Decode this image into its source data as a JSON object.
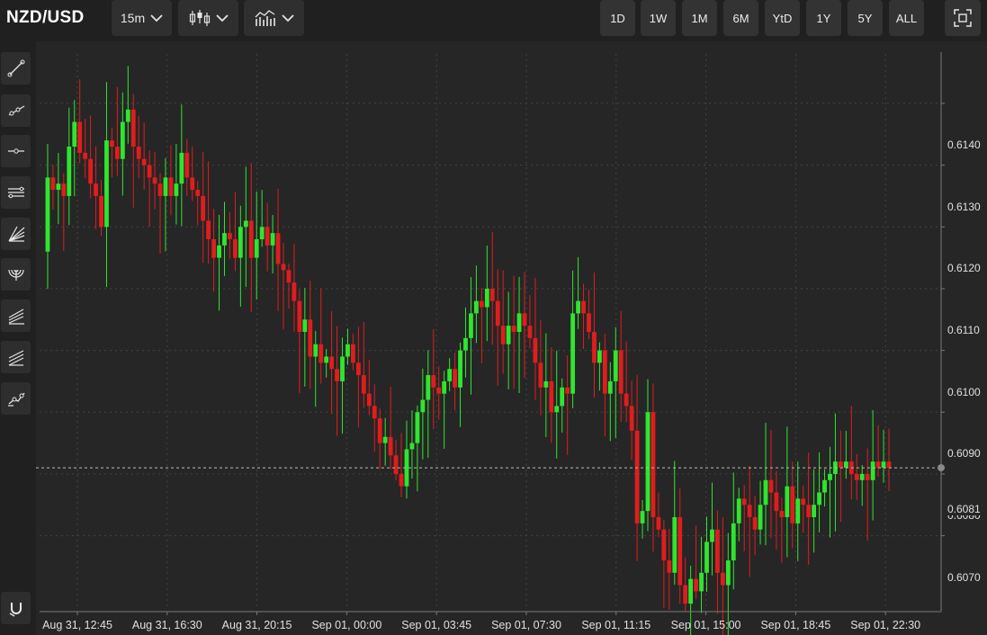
{
  "header": {
    "symbol": "NZD/USD",
    "interval": "15m",
    "candle_style_icon": "candlestick-icon",
    "indicators_icon": "indicators-icon",
    "ranges": [
      "1D",
      "1W",
      "1M",
      "6M",
      "YtD",
      "1Y",
      "5Y",
      "ALL"
    ],
    "fullscreen_icon": "fullscreen-icon"
  },
  "tools": [
    "trend-line-icon",
    "ray-icon",
    "horizontal-line-icon",
    "parallel-channel-icon",
    "fib-fan-icon",
    "fib-arc-icon",
    "pitchfork-icon",
    "regression-channel-icon",
    "polyline-icon",
    "magnet-icon"
  ],
  "colors": {
    "up": "#2ee62e",
    "down": "#e01d1d",
    "background": "#262626",
    "grid": "#444444"
  },
  "chart_data": {
    "type": "candlestick",
    "pair": "NZD/USD",
    "interval": "15m",
    "current_price": "0.6081",
    "current_price_line": 0.6081,
    "ylim": [
      0.6058,
      0.6148
    ],
    "yticks": [
      "0.6140",
      "0.6130",
      "0.6120",
      "0.6110",
      "0.6100",
      "0.6090",
      "0.6080",
      "0.6070"
    ],
    "xticks": [
      "Aug 31, 12:45",
      "Aug 31, 16:30",
      "Aug 31, 20:15",
      "Sep 01, 00:00",
      "Sep 01, 03:45",
      "Sep 01, 07:30",
      "Sep 01, 11:15",
      "Sep 01, 15:00",
      "Sep 01, 18:45",
      "Sep 01, 22:30"
    ],
    "grid": true,
    "close_path": [
      0.6116,
      0.6128,
      0.6126,
      0.6127,
      0.6125,
      0.6133,
      0.6137,
      0.6132,
      0.6131,
      0.6127,
      0.6125,
      0.612,
      0.6134,
      0.6133,
      0.6131,
      0.6137,
      0.6139,
      0.6133,
      0.6131,
      0.613,
      0.6128,
      0.6127,
      0.6125,
      0.6128,
      0.6125,
      0.6127,
      0.6132,
      0.6128,
      0.6126,
      0.6125,
      0.6121,
      0.6118,
      0.6115,
      0.6117,
      0.6119,
      0.6118,
      0.6115,
      0.612,
      0.6121,
      0.6115,
      0.6118,
      0.612,
      0.6117,
      0.6119,
      0.6114,
      0.6113,
      0.6111,
      0.6108,
      0.6103,
      0.6105,
      0.6099,
      0.6101,
      0.6098,
      0.6099,
      0.6097,
      0.6095,
      0.6099,
      0.6101,
      0.6098,
      0.6096,
      0.6093,
      0.6091,
      0.6089,
      0.6085,
      0.6086,
      0.6083,
      0.608,
      0.6078,
      0.6084,
      0.6085,
      0.609,
      0.6092,
      0.6096,
      0.6094,
      0.6093,
      0.6095,
      0.6097,
      0.6094,
      0.61,
      0.6102,
      0.6106,
      0.6108,
      0.6107,
      0.611,
      0.6108,
      0.6104,
      0.6101,
      0.6104,
      0.6103,
      0.6106,
      0.6104,
      0.6102,
      0.6098,
      0.6094,
      0.6095,
      0.609,
      0.6091,
      0.6094,
      0.6093,
      0.6106,
      0.6108,
      0.6106,
      0.6103,
      0.6098,
      0.61,
      0.6093,
      0.6095,
      0.61,
      0.6093,
      0.6091,
      0.6087,
      0.6072,
      0.6074,
      0.609,
      0.6073,
      0.6071,
      0.6066,
      0.6064,
      0.6073,
      0.6062,
      0.6059,
      0.6063,
      0.6061,
      0.6064,
      0.6069,
      0.6071,
      0.6064,
      0.6062,
      0.6066,
      0.6072,
      0.6076,
      0.6075,
      0.6073,
      0.6071,
      0.6075,
      0.6079,
      0.6077,
      0.6074,
      0.6073,
      0.6078,
      0.6072,
      0.6076,
      0.6075,
      0.6073,
      0.6075,
      0.6077,
      0.6079,
      0.608,
      0.6082,
      0.6081,
      0.6082,
      0.608,
      0.6079,
      0.608,
      0.6079,
      0.6082,
      0.6081,
      0.6082,
      0.6081
    ]
  }
}
